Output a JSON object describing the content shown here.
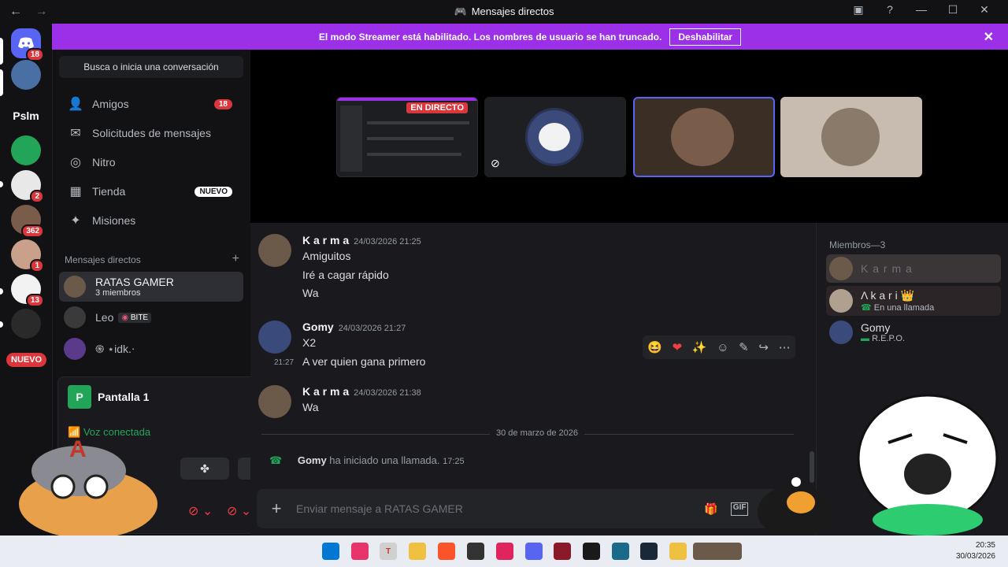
{
  "titlebar": {
    "title": "Mensajes directos",
    "back": "←",
    "forward": "→"
  },
  "banner": {
    "text": "El modo Streamer está habilitado. Los nombres de usuario se han truncado.",
    "button": "Deshabilitar"
  },
  "guilds": [
    {
      "label": "",
      "badge": "18",
      "color": "#5865f2"
    },
    {
      "label": "",
      "badge": "",
      "color": "#4a6fa5"
    },
    {
      "label": "Pslm",
      "badge": "",
      "color": "#121214"
    },
    {
      "label": "",
      "badge": "",
      "color": "#23a559"
    },
    {
      "label": "",
      "badge": "2",
      "color": "#e8e8e8"
    },
    {
      "label": "",
      "badge": "362",
      "color": "#7a5c4a"
    },
    {
      "label": "",
      "badge": "1",
      "color": "#c9a08a"
    },
    {
      "label": "",
      "badge": "13",
      "color": "#f2f2f2"
    },
    {
      "label": "",
      "badge": "",
      "color": "#2a2a2a"
    }
  ],
  "guilds_new": "NUEVO",
  "sidebar": {
    "search": "Busca o inicia una conversación",
    "nav": [
      {
        "label": "Amigos",
        "pill": "18",
        "icon": "👤"
      },
      {
        "label": "Solicitudes de mensajes",
        "pill": "",
        "icon": "✉"
      },
      {
        "label": "Nitro",
        "pill": "",
        "icon": "◎"
      },
      {
        "label": "Tienda",
        "pill": "NUEVO",
        "icon": "▦"
      },
      {
        "label": "Misiones",
        "pill": "",
        "icon": "✦"
      }
    ],
    "dm_header": "Mensajes directos",
    "dm_add": "+",
    "dms": [
      {
        "name": "RATAS GAMER",
        "sub": "3 miembros"
      },
      {
        "name": "Leo",
        "tag": "BITE"
      },
      {
        "name": "֍ ⋆idk.⋅"
      }
    ]
  },
  "voice": {
    "title": "Pantalla 1",
    "p_letter": "P",
    "status": "Voz conectada"
  },
  "stage": {
    "live": "EN DIRECTO"
  },
  "messages": [
    {
      "name": "K a r m a",
      "time": "24/03/2026 21:25",
      "lines": [
        "Amiguitos",
        "Iré a cagar rápido",
        "Wa"
      ]
    },
    {
      "name": "Gomy",
      "time": "24/03/2026 21:27",
      "lines": [
        "X2"
      ],
      "followup_time": "21:27",
      "followup": "A ver quien gana primero"
    },
    {
      "name": "K a r m a",
      "time": "24/03/2026 21:38",
      "lines": [
        "Wa"
      ]
    }
  ],
  "divider": "30 de marzo de 2026",
  "call": {
    "name": "Gomy",
    "text": "ha iniciado una llamada.",
    "time": "17:25"
  },
  "composer": {
    "placeholder": "Enviar mensaje a RATAS GAMER",
    "gif": "GIF"
  },
  "members": {
    "header": "Miembros—3",
    "list": [
      {
        "name": "K a r m a",
        "status": ""
      },
      {
        "name": "Λ k a r i 👑",
        "status": "En una llamada"
      },
      {
        "name": "Gomy",
        "status": "R.E.P.O."
      }
    ]
  },
  "toolbar_icons": [
    "😆",
    "❤",
    "✨",
    "☺",
    "✎",
    "↪",
    "⋯"
  ],
  "clock": {
    "time": "20:35",
    "date": "30/03/2026"
  }
}
